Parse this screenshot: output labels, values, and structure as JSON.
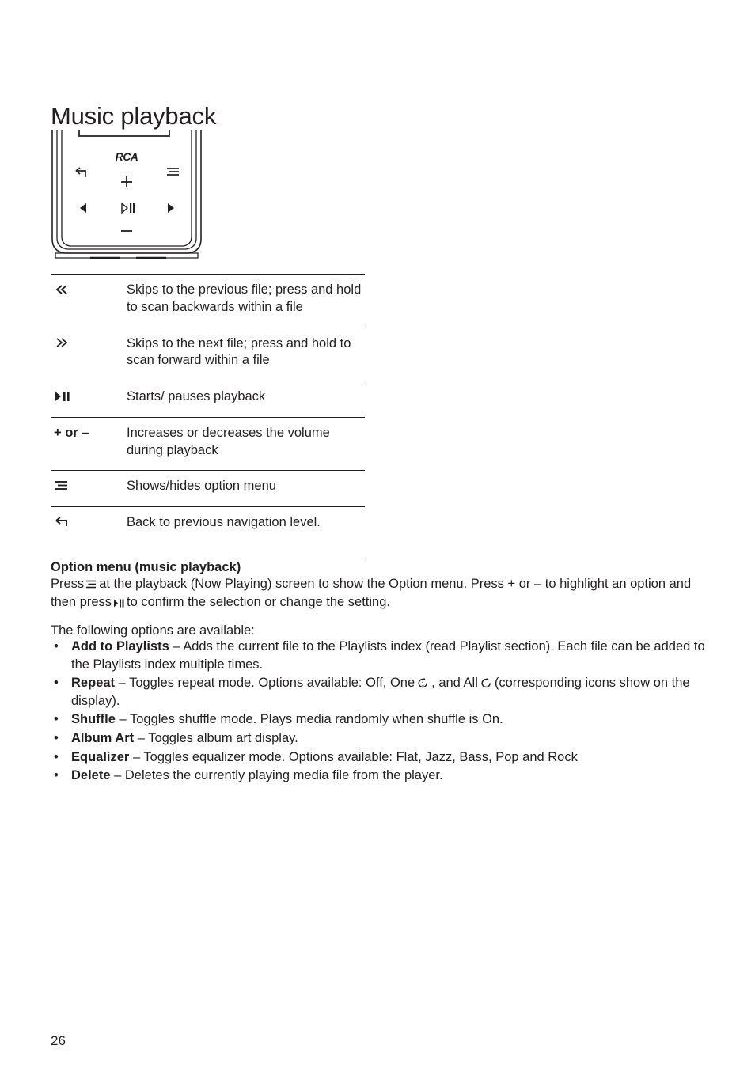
{
  "document": {
    "title": "Music playback",
    "page_number": "26"
  },
  "device": {
    "brand_logo": "RCA",
    "button_icons": [
      "back-icon",
      "menu-icon",
      "volume-up-plus",
      "previous-icon",
      "play-pause-icon",
      "next-icon",
      "volume-down-minus"
    ]
  },
  "key_table": {
    "rows": [
      {
        "icon": "previous-double-chevron-left",
        "description": "Skips to the previous file; press and hold to scan backwards within a file"
      },
      {
        "icon": "next-double-chevron-right",
        "description": "Skips to the next file; press and hold to scan forward within a file"
      },
      {
        "icon": "play-pause",
        "description": "Starts/ pauses playback"
      },
      {
        "icon": "plus-or-minus",
        "label": "+ or –",
        "description": "Increases or decreases the volume during playback"
      },
      {
        "icon": "option-menu-lines",
        "description": "Shows/hides option menu"
      },
      {
        "icon": "back-arrow",
        "description": "Back to previous navigation level."
      }
    ]
  },
  "option_menu": {
    "heading": "Option menu (music playback)",
    "intro_part_1": "Press",
    "intro_part_2": "at the playback (Now Playing) screen to show the Option menu. Press + or – to highlight an option and then press",
    "intro_part_3": "to confirm the selection or change the setting.",
    "available_line": "The following options are available:",
    "bullet_marker": "•",
    "options": [
      {
        "name": "Add to Playlists",
        "text": " – Adds the current file to the Playlists index (read Playlist section).  Each file can be added to the Playlists index multiple times."
      },
      {
        "name": "Repeat",
        "text_before_icon1": " – Toggles repeat mode. Options available: Off, One",
        "text_between_icons": ", and All",
        "text_after_icon2": "(corresponding icons show on the display)."
      },
      {
        "name": "Shuffle",
        "text": " – Toggles shuffle mode. Plays media randomly when shuffle is On."
      },
      {
        "name": "Album Art",
        "text": " – Toggles album art display."
      },
      {
        "name": "Equalizer",
        "text": " – Toggles equalizer mode. Options available: Flat, Jazz, Bass, Pop and Rock"
      },
      {
        "name": "Delete",
        "text": " – Deletes the currently playing media file from the player."
      }
    ]
  },
  "colors": {
    "text": "#231f20",
    "rule": "#231f20",
    "background": "#ffffff"
  }
}
